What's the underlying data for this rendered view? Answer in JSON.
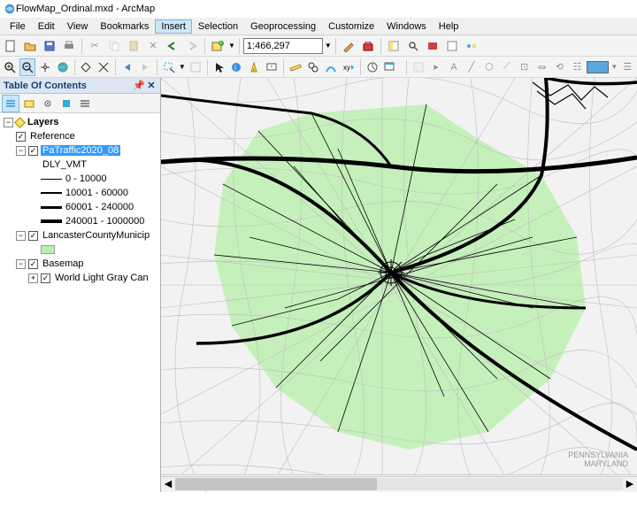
{
  "window": {
    "title": "FlowMap_Ordinal.mxd - ArcMap"
  },
  "menu": {
    "items": [
      "File",
      "Edit",
      "View",
      "Bookmarks",
      "Insert",
      "Selection",
      "Geoprocessing",
      "Customize",
      "Windows",
      "Help"
    ],
    "active_index": 4
  },
  "toolbar1": {
    "scale": "1:466,297"
  },
  "toc": {
    "title": "Table Of Contents",
    "root": "Layers",
    "reference": "Reference",
    "traffic": {
      "name": "PaTraffic2020_08",
      "field": "DLY_VMT",
      "classes": [
        "0 - 10000",
        "10001 - 60000",
        "60001 - 240000",
        "240001 - 1000000"
      ]
    },
    "county": "LancasterCountyMunicip",
    "basemap_group": "Basemap",
    "basemap_layer": "World Light Gray Can"
  },
  "map": {
    "attr_line1": "PENNSYLVANIA",
    "attr_line2": "MARYLAND"
  }
}
